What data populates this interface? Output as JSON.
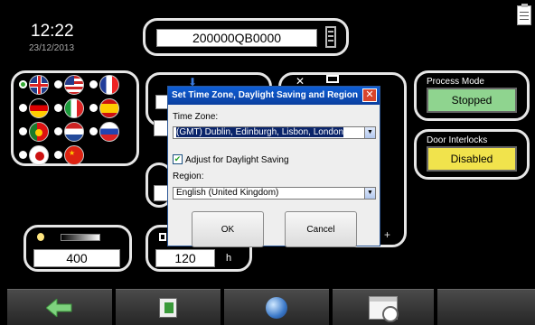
{
  "header": {
    "time": "12:22",
    "date": "23/12/2013",
    "serial": "200000QB0000"
  },
  "process_mode": {
    "label": "Process Mode",
    "value": "Stopped",
    "color": "#8fd48f"
  },
  "door_interlocks": {
    "label": "Door Interlocks",
    "value": "Disabled",
    "color": "#f1e34c"
  },
  "brightness": {
    "value": "400"
  },
  "timeout": {
    "value": "120",
    "unit": "h"
  },
  "flags": [
    "gb",
    "us",
    "fr",
    "de",
    "it",
    "es",
    "pt",
    "nl",
    "ru",
    "jp",
    "cn"
  ],
  "dialog": {
    "title": "Set Time Zone, Daylight Saving and Region",
    "close": "✕",
    "timezone_label": "Time Zone:",
    "timezone_value": "(GMT) Dublin, Edinburgh, Lisbon, London",
    "dst_label": "Adjust for Daylight Saving",
    "dst_checked": true,
    "region_label": "Region:",
    "region_value": "English (United Kingdom)",
    "ok": "OK",
    "cancel": "Cancel"
  },
  "panel_glyph": "+",
  "nav": [
    "back-arrow-icon",
    "save-icon",
    "globe-icon",
    "calendar-clock-icon",
    ""
  ]
}
